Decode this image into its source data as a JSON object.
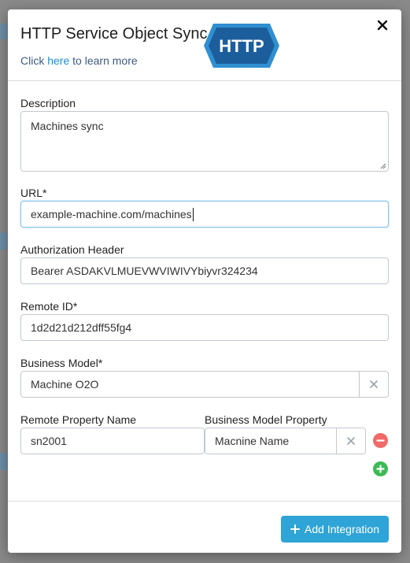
{
  "modal": {
    "title": "HTTP Service Object Sync",
    "logo_text": "HTTP",
    "learn_more_prefix": "Click ",
    "learn_more_link": "here",
    "learn_more_suffix": " to learn more"
  },
  "form": {
    "description": {
      "label": "Description",
      "value": "Machines sync"
    },
    "url": {
      "label": "URL*",
      "value": "example-machine.com/machines"
    },
    "authorization": {
      "label": "Authorization Header",
      "value": "Bearer ASDAKVLMUEVWVIWIVYbiyvr324234"
    },
    "remote_id": {
      "label": "Remote ID*",
      "value": "1d2d21d212dff55fg4"
    },
    "business_model": {
      "label": "Business Model*",
      "value": "Machine O2O"
    },
    "mapping": {
      "remote_header": "Remote Property Name",
      "model_header": "Business Model Property",
      "rows": [
        {
          "remote": "sn2001",
          "model": "Macnine Name"
        }
      ]
    }
  },
  "footer": {
    "add_integration_label": "Add Integration"
  },
  "colors": {
    "primary": "#2fa4d6",
    "remove": "#f06a6a",
    "add": "#3cba54",
    "link": "#1a8fd6"
  }
}
